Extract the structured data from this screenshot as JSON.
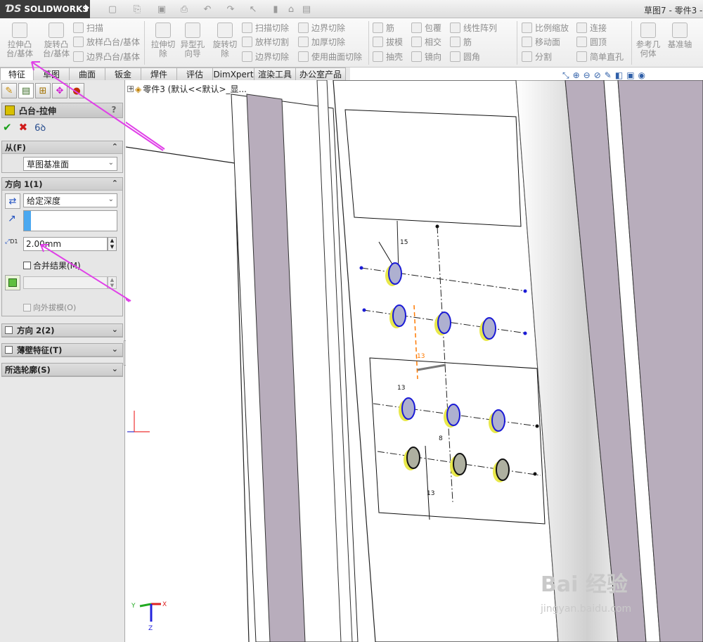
{
  "app": {
    "brand": "SOLIDWORKS",
    "doc_title": "草图7 - 零件3 -"
  },
  "toolbar": {
    "extrude_boss": "拉伸凸\n台/基体",
    "revolve_boss": "旋转凸\n台/基体",
    "sweep": "扫描",
    "loft_boss": "放样凸台/基体",
    "boundary_boss": "边界凸台/基体",
    "extrude_cut": "拉伸切\n除",
    "hole_wizard": "异型孔\n向导",
    "revolve_cut": "旋转切\n除",
    "sweep_cut": "扫描切除",
    "loft_cut": "放样切割",
    "boundary_cut": "边界切除",
    "fillet_group_top": "边界切除",
    "thicken_cut": "加厚切除",
    "surface_cut": "使用曲面切除",
    "rib": "筋",
    "draft": "拔模",
    "shell": "抽壳",
    "wrap": "包覆",
    "intersect": "相交",
    "mirror": "镜向",
    "linear_pattern": "线性阵列",
    "rib2": "筋",
    "fillet": "圆角",
    "scale": "比例缩放",
    "move_face": "移动面",
    "split": "分割",
    "connect": "连接",
    "dome": "圆顶",
    "simple_hole": "简单直孔",
    "ref_geometry": "参考几\n何体",
    "ref_axis": "基准轴"
  },
  "tabs": [
    {
      "label": "特征"
    },
    {
      "label": "草图"
    },
    {
      "label": "曲面"
    },
    {
      "label": "钣金"
    },
    {
      "label": "焊件"
    },
    {
      "label": "评估"
    },
    {
      "label": "DimXpert"
    },
    {
      "label": "渲染工具"
    },
    {
      "label": "办公室产品"
    }
  ],
  "feature": {
    "title": "凸台-拉伸",
    "help": "?",
    "from_label": "从(F)",
    "from_value": "草图基准面",
    "dir1_label": "方向 1(1)",
    "end_condition": "给定深度",
    "depth": "2.00mm",
    "depth_symbol": "D1",
    "merge_result": "合并结果(M)",
    "draft_outward": "向外拔模(O)",
    "dir2_label": "方向 2(2)",
    "thin_label": "薄壁特征(T)",
    "contours_label": "所选轮廓(S)"
  },
  "tree": {
    "part": "零件3 (默认<<默认>_显..."
  },
  "dims": {
    "d1": "15",
    "d2": "13",
    "d3": "13",
    "d4": "13",
    "d5": "8"
  },
  "axis": {
    "x": "X",
    "y": "Y",
    "z": "Z"
  },
  "watermark": {
    "text": "Bai 经验",
    "url": "jingyan.baidu.com"
  },
  "colors": {
    "accent_arrow": "#e040e8",
    "sketch_blue": "#1a1ad6",
    "boss_yellow": "#e8e84a",
    "panel_bg": "#e8e8e8"
  }
}
